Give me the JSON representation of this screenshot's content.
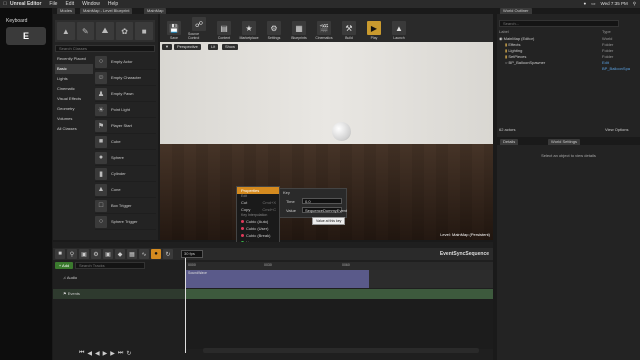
{
  "menubar": {
    "apple": "",
    "app": "Unreal Editor",
    "items": [
      "File",
      "Edit",
      "Window",
      "Help"
    ],
    "status": [
      "Wed 7:35 PM"
    ]
  },
  "keyboard": {
    "title": "Keyboard",
    "key": "E"
  },
  "modes": {
    "tab": "Modes",
    "search_placeholder": "Search Classes",
    "categories": [
      "Recently Placed",
      "Basic",
      "Lights",
      "Cinematic",
      "Visual Effects",
      "Geometry",
      "Volumes",
      "All Classes"
    ],
    "selected_category": "Basic",
    "items": [
      "Empty Actor",
      "Empty Character",
      "Empty Pawn",
      "Point Light",
      "Player Start",
      "Cube",
      "Sphere",
      "Cylinder",
      "Cone",
      "Box Trigger",
      "Sphere Trigger"
    ]
  },
  "doc_tabs": [
    "MainMap - Level Blueprint",
    "MainMap"
  ],
  "toolbar": {
    "buttons": [
      "Save",
      "Source Control",
      "Content",
      "Marketplace",
      "Settings",
      "Blueprints",
      "Cinematics",
      "Build",
      "Play",
      "Launch"
    ]
  },
  "viewport": {
    "buttons": [
      "Perspective",
      "Lit",
      "Show"
    ],
    "level": "Level:  MainMap (Persistent)"
  },
  "context_menu": {
    "properties": "Properties",
    "edit_header": "Edit",
    "cut": "Cut",
    "copy": "Copy",
    "cut_shortcut": "Cmd+X",
    "copy_shortcut": "Cmd+C",
    "interp_header": "Key Interpolation",
    "interp": [
      {
        "label": "Cubic (Auto)",
        "color": "#e03a5a"
      },
      {
        "label": "Cubic (User)",
        "color": "#e03a5a"
      },
      {
        "label": "Cubic (Break)",
        "color": "#e03a5a"
      },
      {
        "label": "Linear",
        "color": "#3ab84a"
      },
      {
        "label": "Constant",
        "color": "#3a8ad8"
      }
    ],
    "keys_header": "Keys",
    "keys": [
      "Set Key Frame",
      "Snap to Frame",
      "Delete"
    ]
  },
  "key_panel": {
    "title": "Key",
    "time_label": "Time",
    "time_value": "0.0",
    "value_label": "Value",
    "value_value": "SequenceDummyEvent",
    "tooltip": "Value at this key"
  },
  "outliner": {
    "tab": "World Outliner",
    "search_placeholder": "Search...",
    "col_label": "Label",
    "col_type": "Type",
    "rows": [
      {
        "label": "MainMap (Editor)",
        "type": "World"
      },
      {
        "label": "Effects",
        "type": "Folder"
      },
      {
        "label": "Lighting",
        "type": "Folder"
      },
      {
        "label": "SetPieces",
        "type": "Folder"
      },
      {
        "label": "BP_BalloonSpawner",
        "type": "Edit BP_BalloonSpa"
      }
    ],
    "count": "62 actors",
    "view_options": "View Options"
  },
  "details": {
    "tabs": [
      "Details",
      "World Settings"
    ],
    "empty": "Select an object to view details"
  },
  "sequencer": {
    "tabs": [
      "Content Browser",
      "Sequencer"
    ],
    "fps": "30 fps",
    "name": "EventSyncSequence",
    "add_button": "+ Add",
    "search_placeholder": "Search Tracks",
    "tracks": [
      "Audio",
      "Events"
    ],
    "audio_clip": "SoundWave",
    "ticks": [
      "0000",
      "0030",
      "0060"
    ]
  },
  "colors": {
    "accent": "#d48a1f",
    "play": "#c99a2e",
    "audio_lane": "#5a5a8a",
    "event_lane": "#3d5a3d"
  }
}
